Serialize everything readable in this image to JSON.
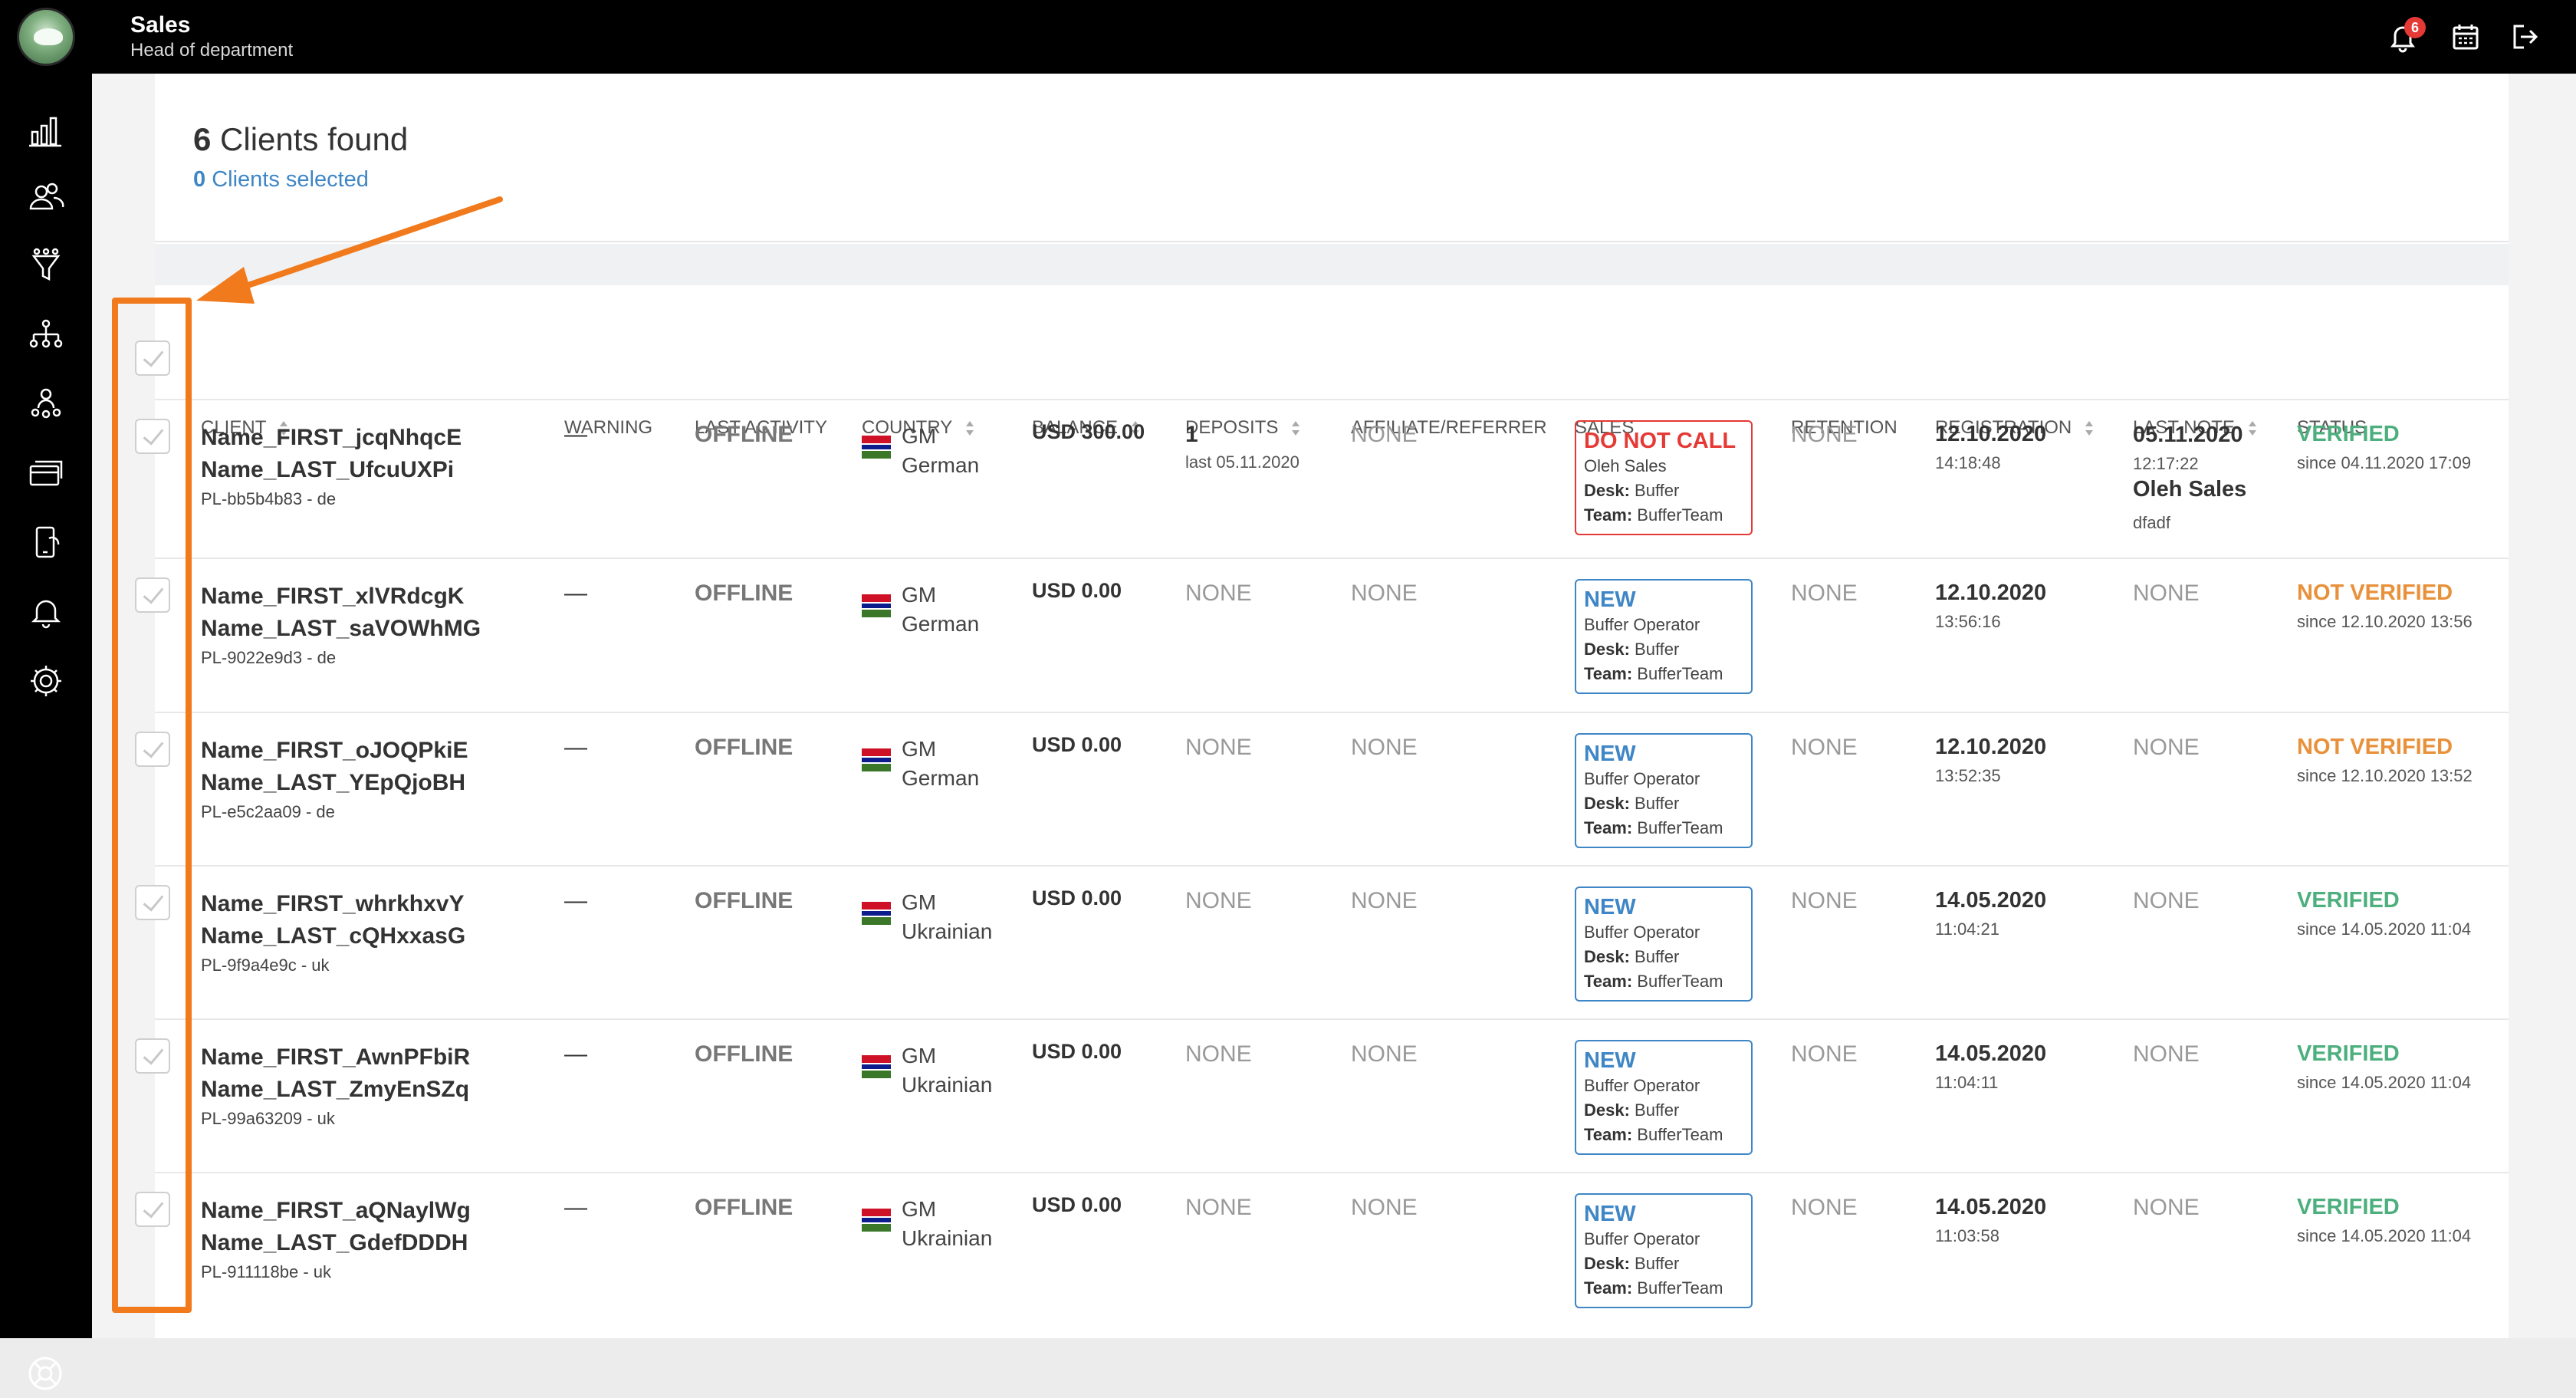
{
  "header": {
    "title": "Sales",
    "subtitle": "Head of department",
    "notification_count": "6"
  },
  "summary": {
    "found_count": "6",
    "found_label": "Clients found",
    "selected_count": "0",
    "selected_label": "Clients selected"
  },
  "columns": {
    "client": "CLIENT",
    "warning": "WARNING",
    "last_activity": "LAST ACTIVITY",
    "country": "COUNTRY",
    "balance": "BALANCE",
    "deposits": "DEPOSITS",
    "affiliate": "AFFILIATE/REFERRER",
    "sales": "SALES",
    "retention": "RETENTION",
    "registration": "REGISTRATION",
    "last_note": "LAST NOTE",
    "status": "STATUS"
  },
  "rows": [
    {
      "first": "Name_FIRST_jcqNhqcE",
      "last": "Name_LAST_UfcuUXPi",
      "id": "PL-bb5b4b83 - de",
      "warning": "—",
      "activity": "OFFLINE",
      "country_code": "GM",
      "language": "German",
      "balance": "USD 300.00",
      "deposits": "1",
      "deposits_last": "last 05.11.2020",
      "affiliate": "NONE",
      "sales_status": "DO NOT CALL",
      "sales_operator": "Oleh Sales",
      "desk_label": "Desk:",
      "desk": "Buffer",
      "team_label": "Team:",
      "team": "BufferTeam",
      "retention": "NONE",
      "reg_date": "12.10.2020",
      "reg_time": "14:18:48",
      "note_date": "05.11.2020",
      "note_time": "12:17:22",
      "note_author": "Oleh Sales",
      "note_text": "dfadf",
      "status": "VERIFIED",
      "status_since": "since 04.11.2020 17:09"
    },
    {
      "first": "Name_FIRST_xlVRdcgK",
      "last": "Name_LAST_saVOWhMG",
      "id": "PL-9022e9d3 - de",
      "warning": "—",
      "activity": "OFFLINE",
      "country_code": "GM",
      "language": "German",
      "balance": "USD 0.00",
      "deposits": "NONE",
      "affiliate": "NONE",
      "sales_status": "NEW",
      "sales_operator": "Buffer Operator",
      "desk_label": "Desk:",
      "desk": "Buffer",
      "team_label": "Team:",
      "team": "BufferTeam",
      "retention": "NONE",
      "reg_date": "12.10.2020",
      "reg_time": "13:56:16",
      "note": "NONE",
      "status": "NOT VERIFIED",
      "status_since": "since 12.10.2020 13:56"
    },
    {
      "first": "Name_FIRST_oJOQPkiE",
      "last": "Name_LAST_YEpQjoBH",
      "id": "PL-e5c2aa09 - de",
      "warning": "—",
      "activity": "OFFLINE",
      "country_code": "GM",
      "language": "German",
      "balance": "USD 0.00",
      "deposits": "NONE",
      "affiliate": "NONE",
      "sales_status": "NEW",
      "sales_operator": "Buffer Operator",
      "desk_label": "Desk:",
      "desk": "Buffer",
      "team_label": "Team:",
      "team": "BufferTeam",
      "retention": "NONE",
      "reg_date": "12.10.2020",
      "reg_time": "13:52:35",
      "note": "NONE",
      "status": "NOT VERIFIED",
      "status_since": "since 12.10.2020 13:52"
    },
    {
      "first": "Name_FIRST_whrkhxvY",
      "last": "Name_LAST_cQHxxasG",
      "id": "PL-9f9a4e9c - uk",
      "warning": "—",
      "activity": "OFFLINE",
      "country_code": "GM",
      "language": "Ukrainian",
      "balance": "USD 0.00",
      "deposits": "NONE",
      "affiliate": "NONE",
      "sales_status": "NEW",
      "sales_operator": "Buffer Operator",
      "desk_label": "Desk:",
      "desk": "Buffer",
      "team_label": "Team:",
      "team": "BufferTeam",
      "retention": "NONE",
      "reg_date": "14.05.2020",
      "reg_time": "11:04:21",
      "note": "NONE",
      "status": "VERIFIED",
      "status_since": "since 14.05.2020 11:04"
    },
    {
      "first": "Name_FIRST_AwnPFbiR",
      "last": "Name_LAST_ZmyEnSZq",
      "id": "PL-99a63209 - uk",
      "warning": "—",
      "activity": "OFFLINE",
      "country_code": "GM",
      "language": "Ukrainian",
      "balance": "USD 0.00",
      "deposits": "NONE",
      "affiliate": "NONE",
      "sales_status": "NEW",
      "sales_operator": "Buffer Operator",
      "desk_label": "Desk:",
      "desk": "Buffer",
      "team_label": "Team:",
      "team": "BufferTeam",
      "retention": "NONE",
      "reg_date": "14.05.2020",
      "reg_time": "11:04:11",
      "note": "NONE",
      "status": "VERIFIED",
      "status_since": "since 14.05.2020 11:04"
    },
    {
      "first": "Name_FIRST_aQNaylWg",
      "last": "Name_LAST_GdefDDDH",
      "id": "PL-911118be - uk",
      "warning": "—",
      "activity": "OFFLINE",
      "country_code": "GM",
      "language": "Ukrainian",
      "balance": "USD 0.00",
      "deposits": "NONE",
      "affiliate": "NONE",
      "sales_status": "NEW",
      "sales_operator": "Buffer Operator",
      "desk_label": "Desk:",
      "desk": "Buffer",
      "team_label": "Team:",
      "team": "BufferTeam",
      "retention": "NONE",
      "reg_date": "14.05.2020",
      "reg_time": "11:03:58",
      "note": "NONE",
      "status": "VERIFIED",
      "status_since": "since 14.05.2020 11:04"
    }
  ],
  "colors": {
    "accent": "#3f86c6",
    "danger": "#e53935",
    "verified": "#4caf7d",
    "not_verified": "#e8913a",
    "annotation": "#f07a1c"
  },
  "icons": {
    "sidebar": [
      "dashboard-icon",
      "clients-icon",
      "leads-icon",
      "hierarchy-icon",
      "operators-icon",
      "payments-icon",
      "callbacks-icon",
      "notifications-icon",
      "settings-icon",
      "help-icon"
    ],
    "topbar": [
      "bell-icon",
      "calendar-icon",
      "logout-icon"
    ]
  }
}
